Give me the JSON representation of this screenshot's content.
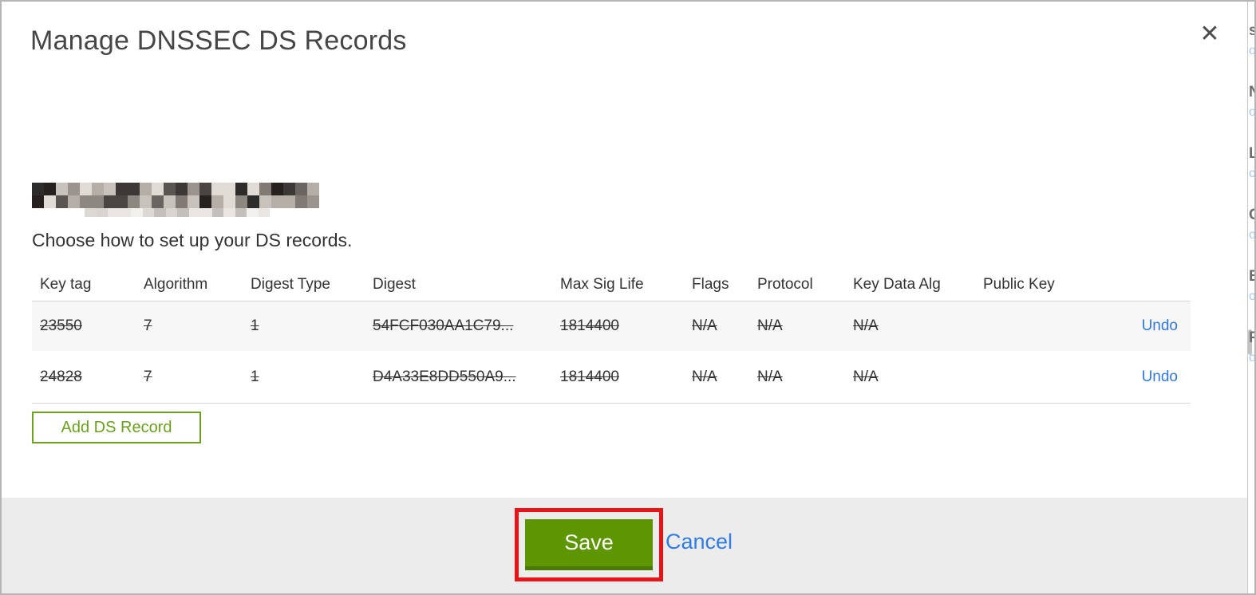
{
  "modal": {
    "title": "Manage DNSSEC DS Records",
    "close_icon": "✕",
    "intro": "Choose how to set up your DS records.",
    "table": {
      "headers": [
        "Key tag",
        "Algorithm",
        "Digest Type",
        "Digest",
        "Max Sig Life",
        "Flags",
        "Protocol",
        "Key Data Alg",
        "Public Key",
        ""
      ],
      "rows": [
        {
          "key_tag": "23550",
          "algorithm": "7",
          "digest_type": "1",
          "digest": "54FCF030AA1C79...",
          "max_sig_life": "1814400",
          "flags": "N/A",
          "protocol": "N/A",
          "key_data_alg": "N/A",
          "public_key": "",
          "action": "Undo",
          "struck": true
        },
        {
          "key_tag": "24828",
          "algorithm": "7",
          "digest_type": "1",
          "digest": "D4A33E8DD550A9...",
          "max_sig_life": "1814400",
          "flags": "N/A",
          "protocol": "N/A",
          "key_data_alg": "N/A",
          "public_key": "",
          "action": "Undo",
          "struck": true
        }
      ]
    },
    "add_button_label": "Add DS Record",
    "footer": {
      "save_label": "Save",
      "cancel_label": "Cancel"
    }
  },
  "colors": {
    "accent_green": "#6aa21e",
    "save_green": "#5d9503",
    "save_green_dark": "#4a7a02",
    "annotation_red": "#e81417",
    "link_blue": "#2f7ce4",
    "undo_blue": "#3078e0",
    "footer_gray": "#ececec",
    "row_stripe": "#f7f7f7"
  },
  "background_sliver": {
    "fragments": [
      {
        "bold": "s",
        "link": "o"
      },
      {
        "bold": "N",
        "link": "o"
      },
      {
        "bold": "L",
        "link": "o"
      },
      {
        "bold": "C",
        "link": "o"
      },
      {
        "bold": "E",
        "link": "o"
      },
      {
        "bold": "P",
        "link": "o"
      }
    ]
  }
}
